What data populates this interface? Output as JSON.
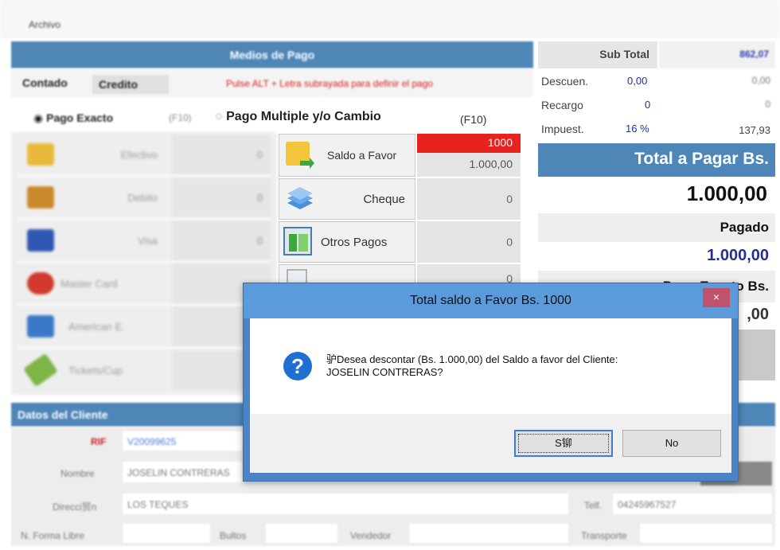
{
  "menu": {
    "archivo": "Archivo"
  },
  "pago": {
    "header": "Medios de Pago",
    "tabs": [
      "Contado",
      "Credito"
    ],
    "hint": "Pulse ALT + Letra subrayada para definir el pago",
    "radio_exacto": "Pago Exacto",
    "radio_exacto_key": "(F10)",
    "radio_multiple": "Pago Multiple y/o Cambio",
    "radio_multiple_key": "(F10)",
    "left_methods": [
      {
        "label": "Efectivo",
        "value": "0",
        "color": "#e8b93a"
      },
      {
        "label": "Debito",
        "value": "0",
        "color": "#c98a2b"
      },
      {
        "label": "Visa",
        "value": "0",
        "color": "#2f57b3"
      },
      {
        "label": "Master Card",
        "value": "0",
        "color": "#d23a2f"
      },
      {
        "label": "American E.",
        "value": "0",
        "color": "#3a79c9"
      },
      {
        "label": "Tickets/Cup",
        "value": "0",
        "color": "#7fb447"
      }
    ],
    "saldo_label": "Saldo a Favor",
    "saldo_red": "1000",
    "saldo_value": "1.000,00",
    "cheque_label": "Cheque",
    "cheque_value": "0",
    "otros_label": "Otros Pagos",
    "otros_value": "0",
    "fourth_value": "0"
  },
  "totales": {
    "subtotal_label": "Sub Total",
    "subtotal_value": "862,07",
    "descuento_label": "Descuen.",
    "descuento_pct": "0,00",
    "descuento_value": "0,00",
    "recargo_label": "Recargo",
    "recargo_pct": "0",
    "recargo_value": "0",
    "impuesto_label": "Impuest.",
    "impuesto_pct": "16 %",
    "impuesto_value": "137,93",
    "total_label": "Total a Pagar Bs.",
    "total_value": "1.000,00",
    "pagado_label": "Pagado",
    "pagado_value": "1.000,00",
    "exacto_label": "Pago Exacto Bs.",
    "exacto_value": ",00"
  },
  "cliente": {
    "header": "Datos del Cliente",
    "rif_label": "RIF",
    "rif_value": "V20099625",
    "nombre_label": "Nombre",
    "nombre_value": "JOSELIN CONTRERAS",
    "direccion_label": "Direcci贸n",
    "direccion_value": "LOS TEQUES",
    "telf_label": "Telf.",
    "telf_value": "04245967527",
    "forma_label": "N. Forma Libre",
    "bultos_label": "Bultos",
    "vendedor_label": "Vendedor",
    "transporte_label": "Transporte"
  },
  "dialog": {
    "title": "Total saldo a Favor Bs. 1000",
    "close": "×",
    "line1": "驴Desea descontar (Bs. 1.000,00) del Saldo a favor del Cliente:",
    "line2": "JOSELIN CONTRERAS?",
    "yes": "S铆",
    "no": "No"
  }
}
